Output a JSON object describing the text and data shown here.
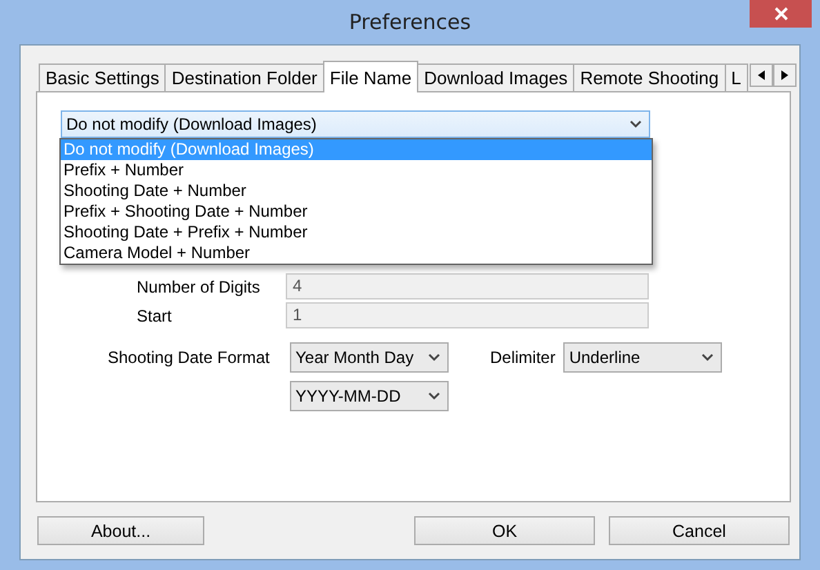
{
  "window": {
    "title": "Preferences"
  },
  "tabs": [
    {
      "label": "Basic Settings",
      "selected": false
    },
    {
      "label": "Destination Folder",
      "selected": false
    },
    {
      "label": "File Name",
      "selected": true
    },
    {
      "label": "Download Images",
      "selected": false
    },
    {
      "label": "Remote Shooting",
      "selected": false
    },
    {
      "label": "L",
      "selected": false
    }
  ],
  "naming": {
    "value": "Do not modify (Download Images)",
    "expanded": true,
    "options": [
      {
        "label": "Do not modify (Download Images)",
        "selected": true
      },
      {
        "label": "Prefix + Number",
        "selected": false
      },
      {
        "label": "Shooting Date + Number",
        "selected": false
      },
      {
        "label": "Prefix + Shooting Date + Number",
        "selected": false
      },
      {
        "label": "Shooting Date + Prefix + Number",
        "selected": false
      },
      {
        "label": "Camera Model + Number",
        "selected": false
      }
    ]
  },
  "fields": [
    {
      "label": "Number of Digits",
      "value": "4",
      "disabled": true
    },
    {
      "label": "Start",
      "value": "1",
      "disabled": true
    }
  ],
  "date_format": {
    "label": "Shooting Date Format",
    "value": "Year Month Day",
    "pattern": "YYYY-MM-DD"
  },
  "delimiter": {
    "label": "Delimiter",
    "value": "Underline"
  },
  "buttons": [
    {
      "label": "About...",
      "kind": "left"
    },
    {
      "label": "OK",
      "kind": "right"
    },
    {
      "label": "Cancel",
      "kind": "right"
    }
  ]
}
